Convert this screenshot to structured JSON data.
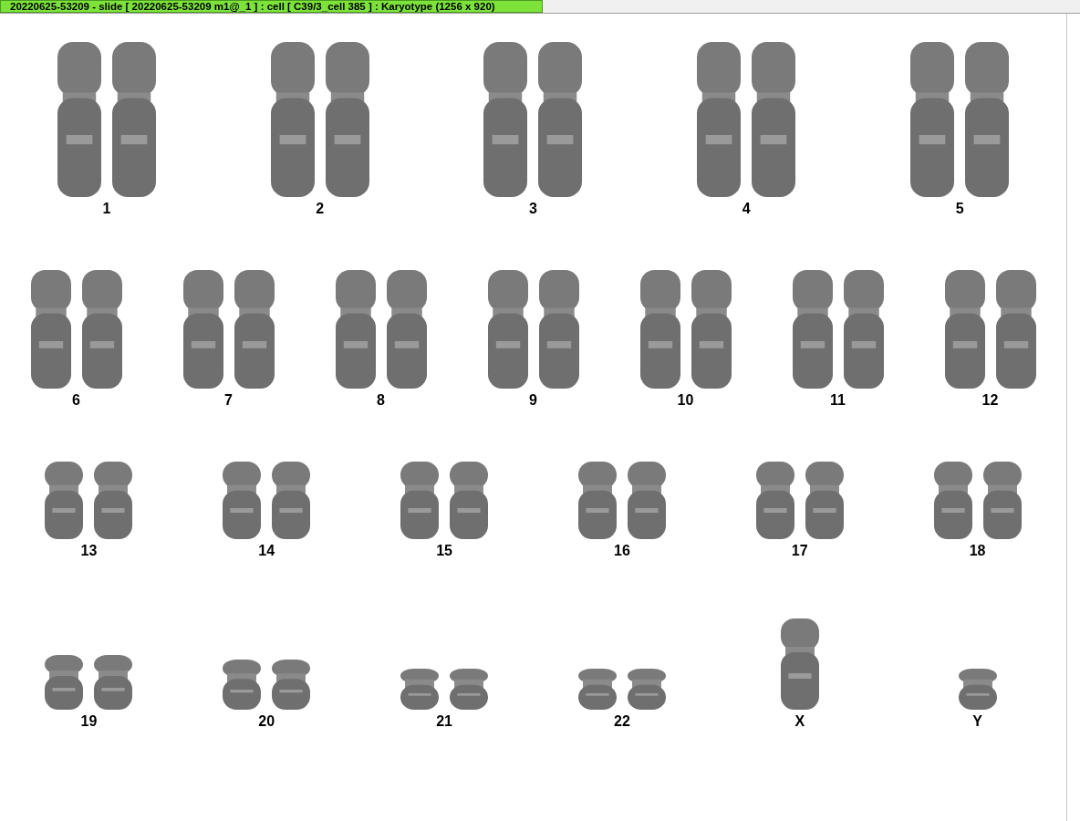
{
  "window": {
    "title": "20220625-53209 - slide [ 20220625-53209 m1@_1 ] : cell [ C39/3_cell 385 ] : Karyotype  (1256 x 920)"
  },
  "rows": [
    {
      "items": [
        {
          "label": "1",
          "kind": "pair"
        },
        {
          "label": "2",
          "kind": "pair"
        },
        {
          "label": "3",
          "kind": "pair"
        },
        {
          "label": "4",
          "kind": "pair"
        },
        {
          "label": "5",
          "kind": "pair"
        }
      ]
    },
    {
      "items": [
        {
          "label": "6",
          "kind": "pair"
        },
        {
          "label": "7",
          "kind": "pair"
        },
        {
          "label": "8",
          "kind": "pair"
        },
        {
          "label": "9",
          "kind": "pair"
        },
        {
          "label": "10",
          "kind": "pair"
        },
        {
          "label": "11",
          "kind": "pair"
        },
        {
          "label": "12",
          "kind": "pair"
        }
      ]
    },
    {
      "items": [
        {
          "label": "13",
          "kind": "pair"
        },
        {
          "label": "14",
          "kind": "pair"
        },
        {
          "label": "15",
          "kind": "pair"
        },
        {
          "label": "16",
          "kind": "pair"
        },
        {
          "label": "17",
          "kind": "pair"
        },
        {
          "label": "18",
          "kind": "pair"
        }
      ]
    },
    {
      "items": [
        {
          "label": "19",
          "kind": "pair"
        },
        {
          "label": "20",
          "kind": "pair"
        },
        {
          "label": "21",
          "kind": "pair"
        },
        {
          "label": "22",
          "kind": "pair"
        },
        {
          "label": "X",
          "kind": "single"
        },
        {
          "label": "Y",
          "kind": "single"
        }
      ]
    }
  ]
}
